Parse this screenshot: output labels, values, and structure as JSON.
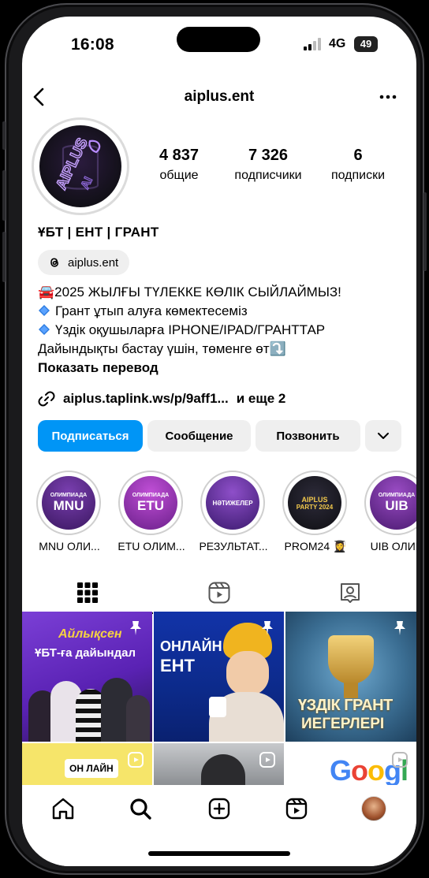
{
  "status_bar": {
    "time": "16:08",
    "network": "4G",
    "battery": "49"
  },
  "header": {
    "username": "aiplus.ent",
    "back_icon": "chevron-left-icon",
    "more_icon": "more-horizontal-icon"
  },
  "stats": [
    {
      "value": "4 837",
      "label": "общие"
    },
    {
      "value": "7 326",
      "label": "подписчики"
    },
    {
      "value": "6",
      "label": "подписки"
    }
  ],
  "profile": {
    "name": "ҰБТ | ЕНТ | ГРАНТ",
    "threads_handle": "aiplus.ent",
    "bio_lines": [
      "🚘2025 ЖЫЛҒЫ ТҮЛЕККЕ КӨЛІК СЫЙЛАЙМЫЗ!",
      "Грант ұтып алуға көмектесеміз",
      "Үздік оқушыларға IPHONE/IPAD/ГРАНТТАР",
      "Дайындықты бастау үшін, төменге өт⤵️"
    ],
    "show_translation": "Показать перевод",
    "link_text": "aiplus.taplink.ws/p/9aff1...",
    "link_more": "и еще 2",
    "avatar_text": "AIPLUS"
  },
  "actions": {
    "follow": "Подписаться",
    "message": "Сообщение",
    "call": "Позвонить"
  },
  "highlights": [
    {
      "caption": "MNU ОЛИ...",
      "small": "ОЛИМПИАДА",
      "big": "MNU",
      "color": "#5a2a82"
    },
    {
      "caption": "ETU ОЛИМ...",
      "small": "ОЛИМПИАДА",
      "big": "ETU",
      "color": "#8a2fa8"
    },
    {
      "caption": "РЕЗУЛЬТАТ...",
      "small": "",
      "big": "НӘТИЖЕЛЕР",
      "color": "#4b2a88"
    },
    {
      "caption": "PROM24 👩‍🎓",
      "small": "AIPLUS",
      "big": "PARTY 2024",
      "color": "#1b1b1f"
    },
    {
      "caption": "UIB ОЛИМ",
      "small": "ОЛИМПИАДА",
      "big": "UIB",
      "color": "#6a2f8a"
    }
  ],
  "posts": [
    {
      "title": "Айлықсен",
      "subtitle": "ҰБТ-ға дайындал"
    },
    {
      "title": "ОНЛАЙН",
      "subtitle": "ЕНТ"
    },
    {
      "title": "ҮЗДІК ГРАНТ",
      "subtitle": "ИЕГЕРЛЕРІ"
    },
    {
      "title": "ОН ЛАЙН",
      "subtitle": ""
    },
    {
      "title": "",
      "subtitle": ""
    },
    {
      "title": "Google",
      "subtitle": ""
    }
  ],
  "colors": {
    "primary": "#0095f6",
    "button_bg": "#efefef",
    "border": "#dbdbdb"
  }
}
